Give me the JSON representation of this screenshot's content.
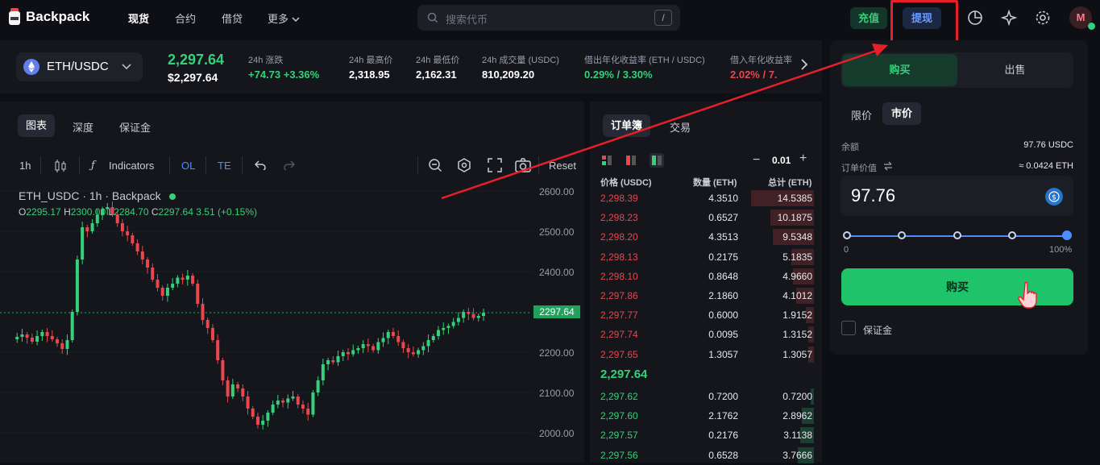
{
  "header": {
    "brand": "Backpack",
    "nav": [
      "现货",
      "合约",
      "借贷",
      "更多"
    ],
    "search_placeholder": "搜索代币",
    "search_shortcut": "/",
    "deposit": "充值",
    "withdraw": "提现",
    "avatar_letter": "M"
  },
  "ticker": {
    "pair": "ETH/USDC",
    "last_price": "2,297.64",
    "usd_price": "$2,297.64",
    "stats": [
      {
        "label": "24h 涨跌",
        "value": "+74.73 +3.36%",
        "tone": "green"
      },
      {
        "label": "24h 最高价",
        "value": "2,318.95",
        "tone": "white"
      },
      {
        "label": "24h 最低价",
        "value": "2,162.31",
        "tone": "white"
      },
      {
        "label": "24h 成交量 (USDC)",
        "value": "810,209.20",
        "tone": "white"
      },
      {
        "label": "借出年化收益率 (ETH / USDC)",
        "value": "0.29% / 3.30%",
        "tone": "green"
      },
      {
        "label": "借入年化收益率",
        "value": "2.02% / 7.",
        "tone": "red"
      }
    ]
  },
  "chart_tabs": [
    "图表",
    "深度",
    "保证金"
  ],
  "chart_toolbar": {
    "interval": "1h",
    "indicators": "Indicators",
    "ol": "OL",
    "te": "TE",
    "reset": "Reset"
  },
  "chart_data": {
    "type": "candlestick",
    "title": "ETH_USDC · 1h · Backpack",
    "ohlc_text": {
      "o": "2295.17",
      "h": "2300.00",
      "l": "2284.70",
      "c": "2297.64",
      "chg": "3.51 (+0.15%)"
    },
    "ylim": [
      1970,
      2640
    ],
    "y_ticks": [
      "2600.00",
      "2500.00",
      "2400.00",
      "2300.00",
      "2200.00",
      "2100.00",
      "2000.00"
    ],
    "last_price_tag": "2297.64",
    "closes": [
      2232,
      2238,
      2244,
      2236,
      2226,
      2240,
      2250,
      2240,
      2232,
      2222,
      2208,
      2230,
      2300,
      2430,
      2510,
      2500,
      2520,
      2540,
      2555,
      2560,
      2542,
      2520,
      2500,
      2490,
      2470,
      2450,
      2430,
      2410,
      2380,
      2360,
      2340,
      2360,
      2370,
      2385,
      2380,
      2390,
      2370,
      2320,
      2280,
      2260,
      2230,
      2180,
      2130,
      2090,
      2120,
      2110,
      2090,
      2060,
      2040,
      2020,
      2030,
      2050,
      2070,
      2080,
      2075,
      2085,
      2090,
      2070,
      2060,
      2045,
      2100,
      2130,
      2170,
      2180,
      2175,
      2190,
      2200,
      2195,
      2205,
      2210,
      2220,
      2215,
      2205,
      2225,
      2235,
      2250,
      2240,
      2225,
      2210,
      2200,
      2195,
      2205,
      2215,
      2230,
      2240,
      2255,
      2260,
      2265,
      2275,
      2285,
      2300,
      2295,
      2285,
      2290,
      2298
    ]
  },
  "orderbook": {
    "tabs": [
      "订单簿",
      "交易"
    ],
    "tick": "0.01",
    "headers": [
      "价格 (USDC)",
      "数量 (ETH)",
      "总计 (ETH)"
    ],
    "asks": [
      [
        "2,298.39",
        "4.3510",
        "14.5385"
      ],
      [
        "2,298.23",
        "0.6527",
        "10.1875"
      ],
      [
        "2,298.20",
        "4.3513",
        "9.5348"
      ],
      [
        "2,298.13",
        "0.2175",
        "5.1835"
      ],
      [
        "2,298.10",
        "0.8648",
        "4.9660"
      ],
      [
        "2,297.86",
        "2.1860",
        "4.1012"
      ],
      [
        "2,297.77",
        "0.6000",
        "1.9152"
      ],
      [
        "2,297.74",
        "0.0095",
        "1.3152"
      ],
      [
        "2,297.65",
        "1.3057",
        "1.3057"
      ]
    ],
    "mid": "2,297.64",
    "bids": [
      [
        "2,297.62",
        "0.7200",
        "0.7200"
      ],
      [
        "2,297.60",
        "2.1762",
        "2.8962"
      ],
      [
        "2,297.57",
        "0.2176",
        "3.1138"
      ],
      [
        "2,297.56",
        "0.6528",
        "3.7666"
      ]
    ]
  },
  "trade": {
    "buy_tab": "购买",
    "sell_tab": "出售",
    "limit": "限价",
    "market": "市价",
    "balance_label": "余额",
    "balance_value": "97.76 USDC",
    "order_value_label": "订单价值",
    "order_value": "≈ 0.0424 ETH",
    "amount": "97.76",
    "slider_min": "0",
    "slider_max": "100%",
    "slider_value_pct": 100,
    "buy_button": "购买",
    "margin_label": "保证金"
  }
}
